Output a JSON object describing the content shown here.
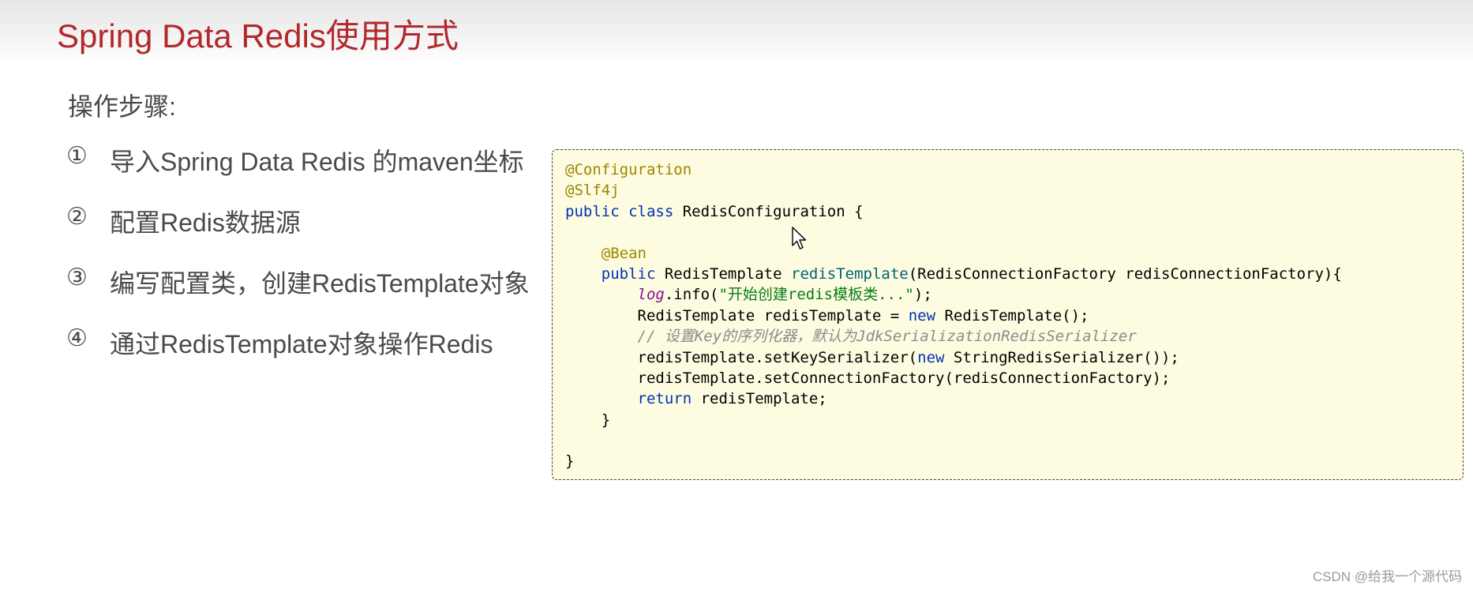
{
  "slide": {
    "title": "Spring Data Redis使用方式",
    "title_color": "#b2282c"
  },
  "steps_heading": "操作步骤:",
  "steps": [
    {
      "num": "①",
      "text": "导入Spring Data Redis 的maven坐标"
    },
    {
      "num": "②",
      "text": "配置Redis数据源"
    },
    {
      "num": "③",
      "text": "编写配置类，创建RedisTemplate对象"
    },
    {
      "num": "④",
      "text": "通过RedisTemplate对象操作Redis"
    }
  ],
  "code": {
    "background": "#fdfbe0",
    "annotation_configuration": "@Configuration",
    "annotation_slf4j": "@Slf4j",
    "kw_public": "public",
    "kw_class": "class",
    "class_name": " RedisConfiguration {",
    "annotation_bean": "@Bean",
    "return_type": " RedisTemplate ",
    "method_name": "redisTemplate",
    "method_params": "(RedisConnectionFactory redisConnectionFactory){",
    "log_var": "log",
    "log_call": ".info(",
    "log_string": "\"开始创建redis模板类...\"",
    "log_end": ");",
    "line_template_decl": "RedisTemplate redisTemplate = ",
    "kw_new": "new",
    "line_template_ctor": " RedisTemplate();",
    "comment": "// 设置Key的序列化器，默认为JdkSerializationRedisSerializer",
    "line_set_key_a": "redisTemplate.setKeySerializer(",
    "line_set_key_b": " StringRedisSerializer());",
    "line_set_factory": "redisTemplate.setConnectionFactory(redisConnectionFactory);",
    "kw_return": "return",
    "line_return_rest": " redisTemplate;",
    "close_method": "}",
    "close_class": "}"
  },
  "watermark": "CSDN @给我一个源代码"
}
